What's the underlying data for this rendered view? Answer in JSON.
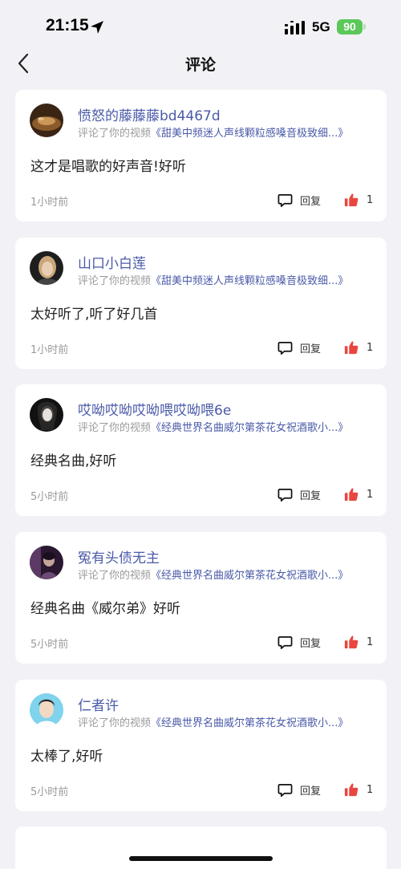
{
  "status_bar": {
    "time": "21:15",
    "network": "5G",
    "battery": "90",
    "icons": [
      "location-arrow-icon",
      "cellular-signal-icon",
      "battery-icon"
    ]
  },
  "nav": {
    "title": "评论",
    "back_icon": "chevron-left-icon"
  },
  "labels": {
    "reply": "回复"
  },
  "colors": {
    "accent_link": "#4a5aa8",
    "like_red": "#e8473f",
    "battery_green": "#5cc85a",
    "page_bg": "#f2f2f6"
  },
  "comments": [
    {
      "username": "愤怒的藤藤藤bd4467d",
      "action": "评论了你的视频",
      "video_title": "《甜美中频迷人声线颗粒感嗓音极致细...》",
      "text": "这才是唱歌的好声音!好听",
      "time_ago": "1小时前",
      "likes": "1"
    },
    {
      "username": "山口小白莲",
      "action": "评论了你的视频",
      "video_title": "《甜美中频迷人声线颗粒感嗓音极致细...》",
      "text": "太好听了,听了好几首",
      "time_ago": "1小时前",
      "likes": "1"
    },
    {
      "username": "哎呦哎呦哎呦喂哎呦喂6e",
      "action": "评论了你的视频",
      "video_title": "《经典世界名曲威尔第茶花女祝酒歌小...》",
      "text": "经典名曲,好听",
      "time_ago": "5小时前",
      "likes": "1"
    },
    {
      "username": "冤有头债无主",
      "action": "评论了你的视频",
      "video_title": "《经典世界名曲威尔第茶花女祝酒歌小...》",
      "text": "经典名曲《威尔弟》好听",
      "time_ago": "5小时前",
      "likes": "1"
    },
    {
      "username": "仁者许",
      "action": "评论了你的视频",
      "video_title": "《经典世界名曲威尔第茶花女祝酒歌小...》",
      "text": "太棒了,好听",
      "time_ago": "5小时前",
      "likes": "1"
    }
  ]
}
